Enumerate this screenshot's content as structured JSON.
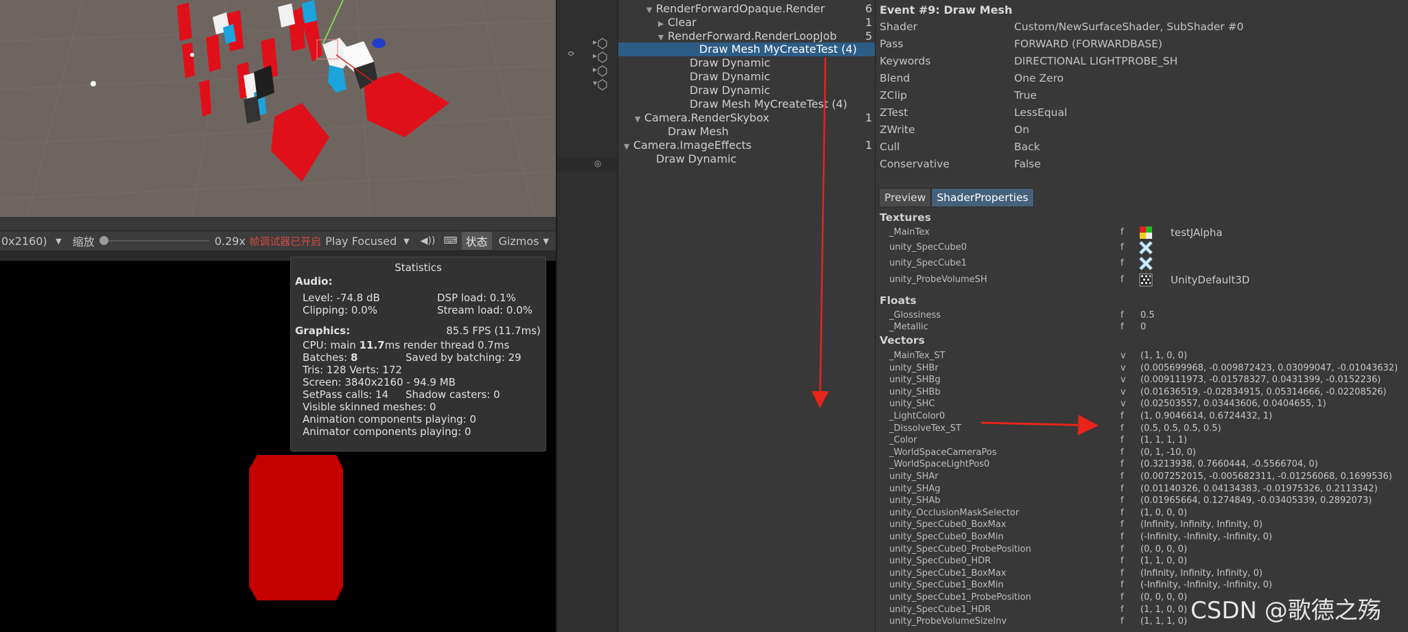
{
  "game_toolbar": {
    "resolution": "0x2160)",
    "scale_label": "缩放",
    "scale_value": "0.29x",
    "scale_fraction": 0.0,
    "debugger_notice": "帧调试器已开启",
    "play_mode": "Play Focused",
    "stats_label": "状态",
    "gizmos_label": "Gizmos"
  },
  "stats": {
    "title": "Statistics",
    "audio_heading": "Audio:",
    "level": "Level: -74.8 dB",
    "dsp_load": "DSP load: 0.1%",
    "clipping": "Clipping: 0.0%",
    "stream_load": "Stream load: 0.0%",
    "graphics_heading": "Graphics:",
    "fps": "85.5 FPS (11.7ms)",
    "cpu_prefix": "CPU: main ",
    "cpu_main": "11.7",
    "cpu_suffix": "ms  render thread 0.7ms",
    "batches_prefix": "Batches: ",
    "batches": "8",
    "saved_by_batching": "Saved by batching: 29",
    "tris_verts": "Tris: 128  Verts: 172",
    "screen": "Screen: 3840x2160 - 94.9 MB",
    "setpass": "SetPass calls: 14",
    "shadow_casters": "Shadow casters: 0",
    "skinned_meshes": "Visible skinned meshes: 0",
    "animation_components": "Animation components playing: 0",
    "animator_components": "Animator components playing: 0"
  },
  "tree": {
    "nodes": [
      {
        "label": "RenderForwardOpaque.Render",
        "count": "6",
        "arrow": "▼"
      },
      {
        "label": "Clear",
        "count": "1",
        "arrow": "▶"
      },
      {
        "label": "RenderForward.RenderLoopJob",
        "count": "5",
        "arrow": "▼"
      },
      {
        "label": "Draw Mesh MyCreateTest (4)",
        "count": "",
        "arrow": ""
      },
      {
        "label": "Draw Dynamic",
        "count": "",
        "arrow": ""
      },
      {
        "label": "Draw Dynamic",
        "count": "",
        "arrow": ""
      },
      {
        "label": "Draw Dynamic",
        "count": "",
        "arrow": ""
      },
      {
        "label": "Draw Mesh MyCreateTest (4)",
        "count": "",
        "arrow": ""
      },
      {
        "label": "Camera.RenderSkybox",
        "count": "1",
        "arrow": "▼"
      },
      {
        "label": "Draw Mesh",
        "count": "",
        "arrow": ""
      },
      {
        "label": "Camera.ImageEffects",
        "count": "1",
        "arrow": "▼"
      },
      {
        "label": "Draw Dynamic",
        "count": "",
        "arrow": ""
      }
    ]
  },
  "detail": {
    "event_title": "Event #9: Draw Mesh",
    "props": [
      {
        "k": "Shader",
        "v": "Custom/NewSurfaceShader, SubShader #0"
      },
      {
        "k": "Pass",
        "v": "FORWARD (FORWARDBASE)"
      },
      {
        "k": "Keywords",
        "v": "DIRECTIONAL LIGHTPROBE_SH"
      },
      {
        "k": "Blend",
        "v": "One Zero"
      },
      {
        "k": "ZClip",
        "v": "True"
      },
      {
        "k": "ZTest",
        "v": "LessEqual"
      },
      {
        "k": "ZWrite",
        "v": "On"
      },
      {
        "k": "Cull",
        "v": "Back"
      },
      {
        "k": "Conservative",
        "v": "False"
      }
    ],
    "tab_preview": "Preview",
    "tab_shader_properties": "ShaderProperties",
    "textures_heading": "Textures",
    "textures": [
      {
        "name": "_MainTex",
        "type": "f",
        "value": "testJAlpha",
        "icon": "color-grid-icon"
      },
      {
        "name": "unity_SpecCube0",
        "type": "f",
        "value": "",
        "icon": "cubemap-icon"
      },
      {
        "name": "unity_SpecCube1",
        "type": "f",
        "value": "",
        "icon": "cubemap-icon"
      },
      {
        "name": "unity_ProbeVolumeSH",
        "type": "f",
        "value": "UnityDefault3D",
        "icon": "texture3d-icon"
      }
    ],
    "floats_heading": "Floats",
    "floats": [
      {
        "name": "_Glossiness",
        "type": "f",
        "value": "0.5"
      },
      {
        "name": "_Metallic",
        "type": "f",
        "value": "0"
      }
    ],
    "vectors_heading": "Vectors",
    "vectors": [
      {
        "name": "_MainTex_ST",
        "type": "v",
        "value": "(1, 1, 0, 0)"
      },
      {
        "name": "unity_SHBr",
        "type": "v",
        "value": "(0.005699968, -0.009872423, 0.03099047, -0.01043632)"
      },
      {
        "name": "unity_SHBg",
        "type": "v",
        "value": "(0.009111973, -0.01578327, 0.0431399, -0.0152236)"
      },
      {
        "name": "unity_SHBb",
        "type": "v",
        "value": "(0.01636519, -0.02834915, 0.05314666, -0.02208526)"
      },
      {
        "name": "unity_SHC",
        "type": "v",
        "value": "(0.02503557, 0.03443606, 0.0404655, 1)"
      },
      {
        "name": "_LightColor0",
        "type": "f",
        "value": "(1, 0.9046614, 0.6724432, 1)"
      },
      {
        "name": "_DissolveTex_ST",
        "type": "f",
        "value": "(0.5, 0.5, 0.5, 0.5)"
      },
      {
        "name": "_Color",
        "type": "f",
        "value": "(1, 1, 1, 1)"
      },
      {
        "name": "_WorldSpaceCameraPos",
        "type": "f",
        "value": "(0, 1, -10, 0)"
      },
      {
        "name": "_WorldSpaceLightPos0",
        "type": "f",
        "value": "(0.3213938, 0.7660444, -0.5566704, 0)"
      },
      {
        "name": "unity_SHAr",
        "type": "f",
        "value": "(0.007252015, -0.005682311, -0.01256068, 0.1699536)"
      },
      {
        "name": "unity_SHAg",
        "type": "f",
        "value": "(0.01140326, 0.04134383, -0.01975326, 0.2113342)"
      },
      {
        "name": "unity_SHAb",
        "type": "f",
        "value": "(0.01965664, 0.1274849, -0.03405339, 0.2892073)"
      },
      {
        "name": "unity_OcclusionMaskSelector",
        "type": "f",
        "value": "(1, 0, 0, 0)"
      },
      {
        "name": "unity_SpecCube0_BoxMax",
        "type": "f",
        "value": "(Infinity, Infinity, Infinity, 0)"
      },
      {
        "name": "unity_SpecCube0_BoxMin",
        "type": "f",
        "value": "(-Infinity, -Infinity, -Infinity, 0)"
      },
      {
        "name": "unity_SpecCube0_ProbePosition",
        "type": "f",
        "value": "(0, 0, 0, 0)"
      },
      {
        "name": "unity_SpecCube0_HDR",
        "type": "f",
        "value": "(1, 1, 0, 0)"
      },
      {
        "name": "unity_SpecCube1_BoxMax",
        "type": "f",
        "value": "(Infinity, Infinity, Infinity, 0)"
      },
      {
        "name": "unity_SpecCube1_BoxMin",
        "type": "f",
        "value": "(-Infinity, -Infinity, -Infinity, 0)"
      },
      {
        "name": "unity_SpecCube1_ProbePosition",
        "type": "f",
        "value": "(0, 0, 0, 0)"
      },
      {
        "name": "unity_SpecCube1_HDR",
        "type": "f",
        "value": "(1, 1, 0, 0)"
      },
      {
        "name": "unity_ProbeVolumeSizeInv",
        "type": "f",
        "value": "(1, 1, 1, 0)"
      }
    ]
  },
  "watermark": "CSDN @歌德之殇",
  "colors": {
    "selection": "#2c5d87",
    "annotation_arrow": "#e8231a",
    "object_red": "#d40000"
  }
}
